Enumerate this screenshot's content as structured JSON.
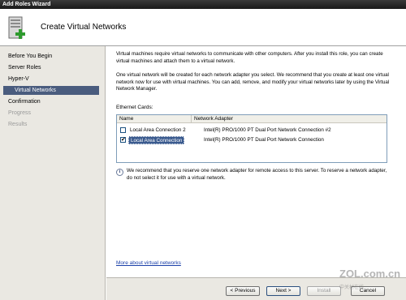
{
  "window": {
    "title": "Add Roles Wizard"
  },
  "header": {
    "title": "Create Virtual Networks",
    "icon": "server-add-icon"
  },
  "sidebar": {
    "items": [
      {
        "label": "Before You Begin",
        "state": "normal"
      },
      {
        "label": "Server Roles",
        "state": "normal"
      },
      {
        "label": "Hyper-V",
        "state": "normal"
      },
      {
        "label": "Virtual Networks",
        "state": "selected"
      },
      {
        "label": "Confirmation",
        "state": "normal"
      },
      {
        "label": "Progress",
        "state": "disabled"
      },
      {
        "label": "Results",
        "state": "disabled"
      }
    ]
  },
  "content": {
    "para1": "Virtual machines require virtual networks to communicate with other computers. After you install this role, you can create virtual machines and attach them to a virtual network.",
    "para2": "One virtual network will be created for each network adapter you select. We recommend that you create at least one virtual network now for use with virtual machines. You can add, remove, and modify your virtual networks later by using the Virtual Network Manager.",
    "ethernet_label": "Ethernet Cards:",
    "columns": [
      "Name",
      "Network Adapter"
    ],
    "rows": [
      {
        "name": "Local Area Connection 2",
        "adapter": "Intel(R) PRO/1000 PT Dual Port Network Connection #2",
        "checked": false,
        "selected": false
      },
      {
        "name": "Local Area Connection",
        "adapter": "Intel(R) PRO/1000 PT Dual Port Network Connection",
        "checked": true,
        "selected": true
      }
    ],
    "info": "We recommend that you reserve one network adapter for remote access to this server. To reserve a network adapter, do not select it for use with a virtual network.",
    "link": "More about virtual networks"
  },
  "buttons": {
    "previous": "< Previous",
    "next": "Next >",
    "install": "Install",
    "cancel": "Cancel"
  },
  "watermark": {
    "text": "ZOL.com.cn",
    "sub": "中关村在线"
  },
  "colors": {
    "selected_nav": "#4a5c7e",
    "sidebar_bg": "#eae8e2",
    "link": "#1a3fa8"
  }
}
